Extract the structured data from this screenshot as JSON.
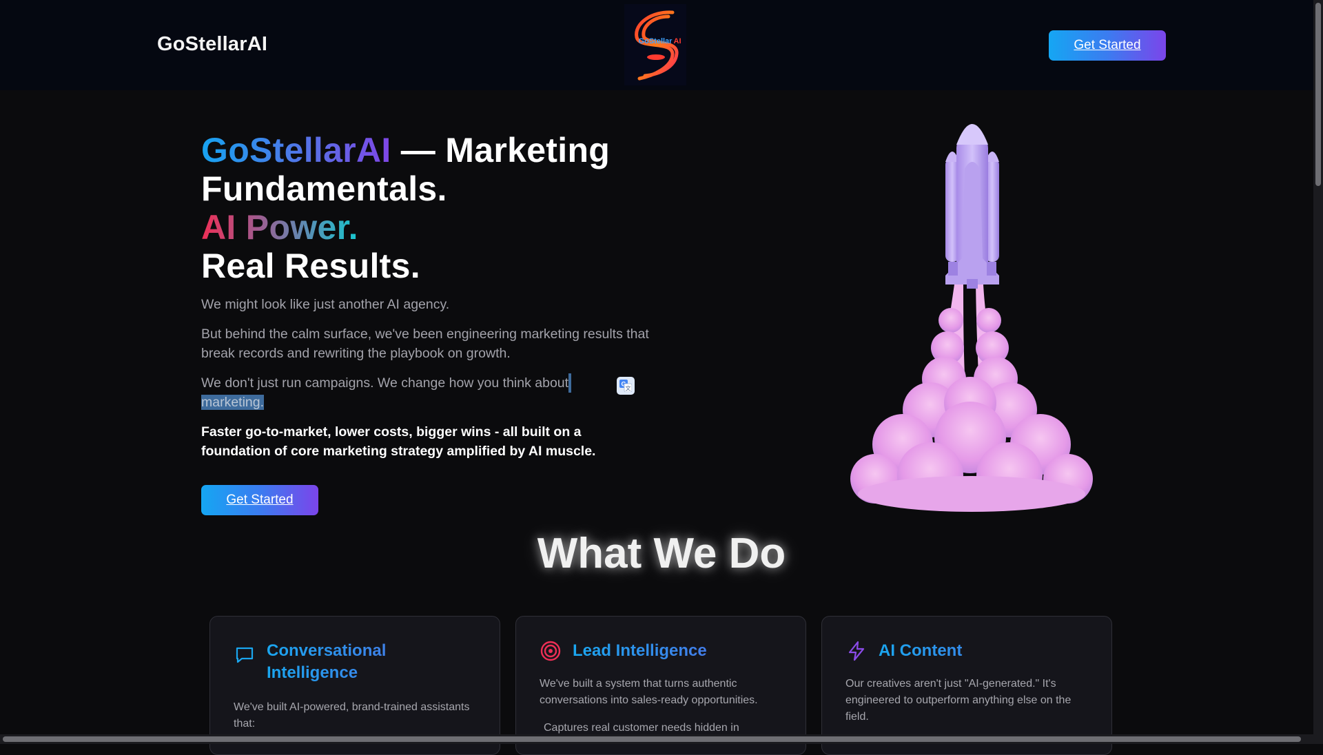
{
  "header": {
    "brand": "GoStellarAI",
    "cta_label": "Get Started"
  },
  "hero": {
    "title_brand": "GoStellarAI",
    "title_rest": " — Marketing",
    "title_line2": "Fundamentals.",
    "title_ai": "AI Power.",
    "title_line4": "Real Results.",
    "p1": "We might look like just another AI agency.",
    "p2": "But behind the calm surface, we've been engineering marketing results that break records and rewriting the playbook on growth.",
    "p3_start": "We don't just run campaigns. We change how you think about",
    "p3_selected": "marketing.",
    "p4": "Faster go-to-market, lower costs, bigger wins - all built on a foundation of core marketing strategy amplified by AI muscle.",
    "cta_label": "Get Started"
  },
  "what_we_do": {
    "title": "What We Do",
    "cards": [
      {
        "title": "Conversational Intelligence",
        "icon": "chat-bubble-icon",
        "text": "We've built AI-powered, brand-trained assistants that:"
      },
      {
        "title": "Lead Intelligence",
        "icon": "target-icon",
        "text": "We've built a system that turns authentic conversations into sales-ready opportunities.",
        "text2": "Captures real customer needs hidden in"
      },
      {
        "title": "AI Content",
        "icon": "lightning-icon",
        "text": "Our creatives aren't just \"AI-generated.\" It's engineered to outperform anything else on the field."
      }
    ]
  },
  "colors": {
    "accent_blue": "#15a6f3",
    "accent_purple": "#7b45ea",
    "background": "#0b0b0d"
  }
}
